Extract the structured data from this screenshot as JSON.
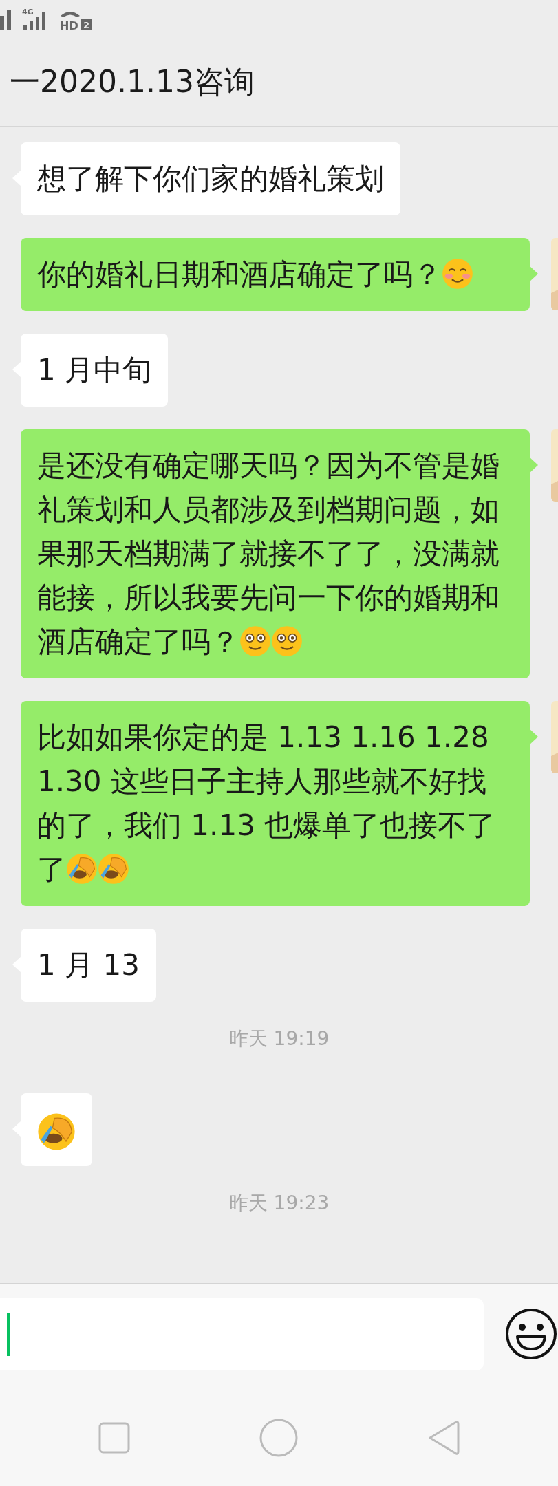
{
  "status_bar": {
    "network_label": "4G",
    "call_label": "HD",
    "sim_label": "2"
  },
  "header": {
    "title": "一2020.1.13咨询"
  },
  "messages": [
    {
      "kind": "message",
      "outgoing": false,
      "text": "想了解下你们家的婚礼策划"
    },
    {
      "kind": "message",
      "outgoing": true,
      "text": "你的婚礼日期和酒店确定了吗？",
      "emojis": [
        {
          "kind": "blush"
        }
      ]
    },
    {
      "kind": "message",
      "outgoing": false,
      "text": "1 月中旬"
    },
    {
      "kind": "message",
      "outgoing": true,
      "text": "是还没有确定哪天吗？因为不管是婚礼策划和人员都涉及到档期问题，如果那天档期满了就接不了了，没满就能接，所以我要先问一下你的婚期和酒店确定了吗？",
      "emojis": [
        {
          "kind": "smile"
        },
        {
          "kind": "smile"
        }
      ]
    },
    {
      "kind": "message",
      "outgoing": true,
      "text": "比如如果你定的是 1.13 1.16 1.28 1.30 这些日子主持人那些就不好找的了，我们 1.13 也爆单了也接不了了",
      "emojis": [
        {
          "kind": "facepalm"
        },
        {
          "kind": "facepalm"
        }
      ]
    },
    {
      "kind": "message",
      "outgoing": false,
      "text": "1 月 13"
    },
    {
      "kind": "time",
      "text": "昨天 19:19"
    },
    {
      "kind": "message",
      "outgoing": false,
      "emojis": [
        {
          "kind": "facepalm"
        }
      ]
    },
    {
      "kind": "time",
      "text": "昨天 19:23"
    }
  ],
  "composer": {
    "focused": true
  }
}
